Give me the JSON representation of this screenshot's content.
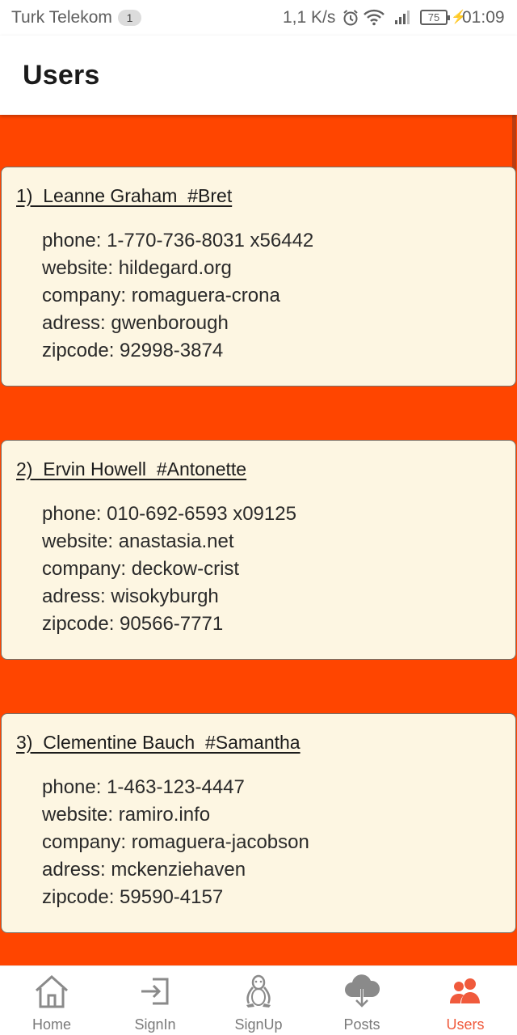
{
  "status_bar": {
    "carrier": "Turk Telekom",
    "notification_count": "1",
    "net_speed": "1,1 K/s",
    "battery": "75",
    "time": "01:09"
  },
  "app_bar": {
    "title": "Users"
  },
  "users": [
    {
      "heading": "1)  Leanne Graham  #Bret",
      "phone": "phone: 1-770-736-8031 x56442",
      "website": "website: hildegard.org",
      "company": "company: romaguera-crona",
      "adress": "adress: gwenborough",
      "zipcode": "zipcode: 92998-3874"
    },
    {
      "heading": "2)  Ervin Howell  #Antonette",
      "phone": "phone: 010-692-6593 x09125",
      "website": "website: anastasia.net",
      "company": "company: deckow-crist",
      "adress": "adress: wisokyburgh",
      "zipcode": "zipcode: 90566-7771"
    },
    {
      "heading": "3)  Clementine Bauch  #Samantha",
      "phone": "phone: 1-463-123-4447",
      "website": "website: ramiro.info",
      "company": "company: romaguera-jacobson",
      "adress": "adress: mckenziehaven",
      "zipcode": "zipcode: 59590-4157"
    }
  ],
  "bottom_nav": {
    "items": [
      {
        "label": "Home",
        "icon": "home-icon"
      },
      {
        "label": "SignIn",
        "icon": "sign-in-icon"
      },
      {
        "label": "SignUp",
        "icon": "linux-penguin-icon"
      },
      {
        "label": "Posts",
        "icon": "cloud-download-icon"
      },
      {
        "label": "Users",
        "icon": "users-icon",
        "active": true
      }
    ]
  },
  "colors": {
    "background": "#ff4500",
    "card": "#fdf6e2",
    "active_tab": "#f05a3c",
    "inactive_tab": "#7a7a7a"
  }
}
